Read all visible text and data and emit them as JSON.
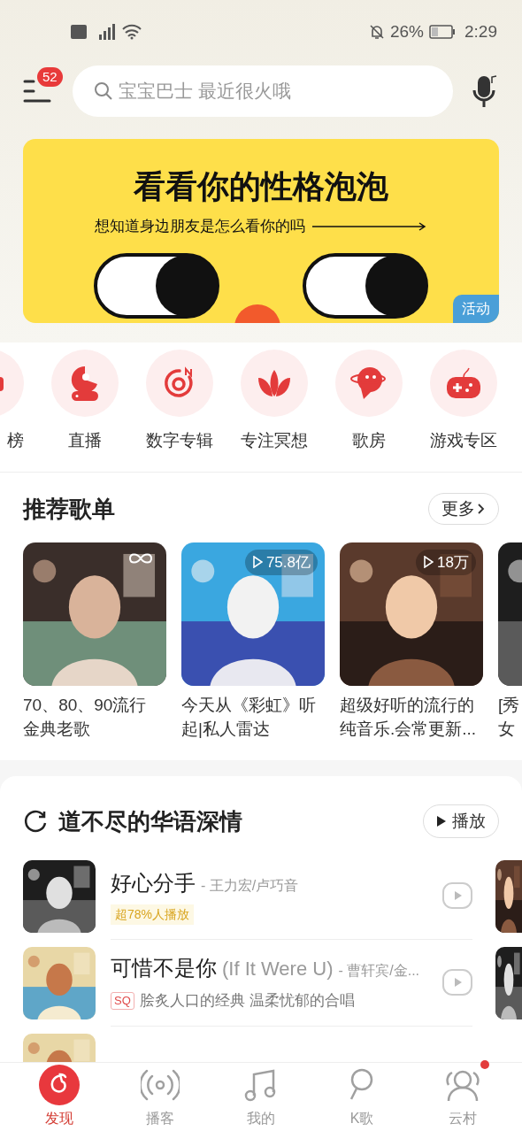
{
  "status_bar": {
    "time": "2:29",
    "battery": "26%"
  },
  "header": {
    "badge": "52",
    "search_placeholder": "宝宝巴士 最近很火哦"
  },
  "banner": {
    "title": "看看你的性格泡泡",
    "subtitle": "想知道身边朋友是怎么看你的吗",
    "tag": "活动"
  },
  "shortcuts": [
    {
      "label": "榜",
      "kind": "chart"
    },
    {
      "label": "直播",
      "kind": "live"
    },
    {
      "label": "数字专辑",
      "kind": "album"
    },
    {
      "label": "专注冥想",
      "kind": "lotus"
    },
    {
      "label": "歌房",
      "kind": "room"
    },
    {
      "label": "游戏专区",
      "kind": "game"
    }
  ],
  "playlists": {
    "title": "推荐歌单",
    "more": "更多",
    "items": [
      {
        "title": "70、80、90流行金典老歌",
        "kind": "loop"
      },
      {
        "title": "今天从《彩虹》听起|私人雷达",
        "plays": "75.8亿",
        "kind": "count"
      },
      {
        "title": "超级好听的流行的纯音乐.会常更新...",
        "plays": "18万",
        "kind": "count"
      },
      {
        "title": "[秀女",
        "kind": "none"
      }
    ]
  },
  "songs": {
    "title": "道不尽的华语深情",
    "play": "播放",
    "items": [
      {
        "title": "好心分手",
        "artist": "- 王力宏/卢巧音",
        "kind": "hot",
        "tag": "超78%人播放"
      },
      {
        "title": "可惜不是你",
        "subtitle": "(If It Were U)",
        "artist": "- 曹轩宾/金...",
        "kind": "sq",
        "tag": "SQ",
        "note": "脍炙人口的经典 温柔忧郁的合唱"
      }
    ]
  },
  "tabs": [
    {
      "label": "发现",
      "selected": true,
      "kind": "discover",
      "dot": false
    },
    {
      "label": "播客",
      "selected": false,
      "kind": "podcast",
      "dot": false
    },
    {
      "label": "我的",
      "selected": false,
      "kind": "music",
      "dot": false
    },
    {
      "label": "K歌",
      "selected": false,
      "kind": "mic",
      "dot": false
    },
    {
      "label": "云村",
      "selected": false,
      "kind": "people",
      "dot": true
    }
  ]
}
